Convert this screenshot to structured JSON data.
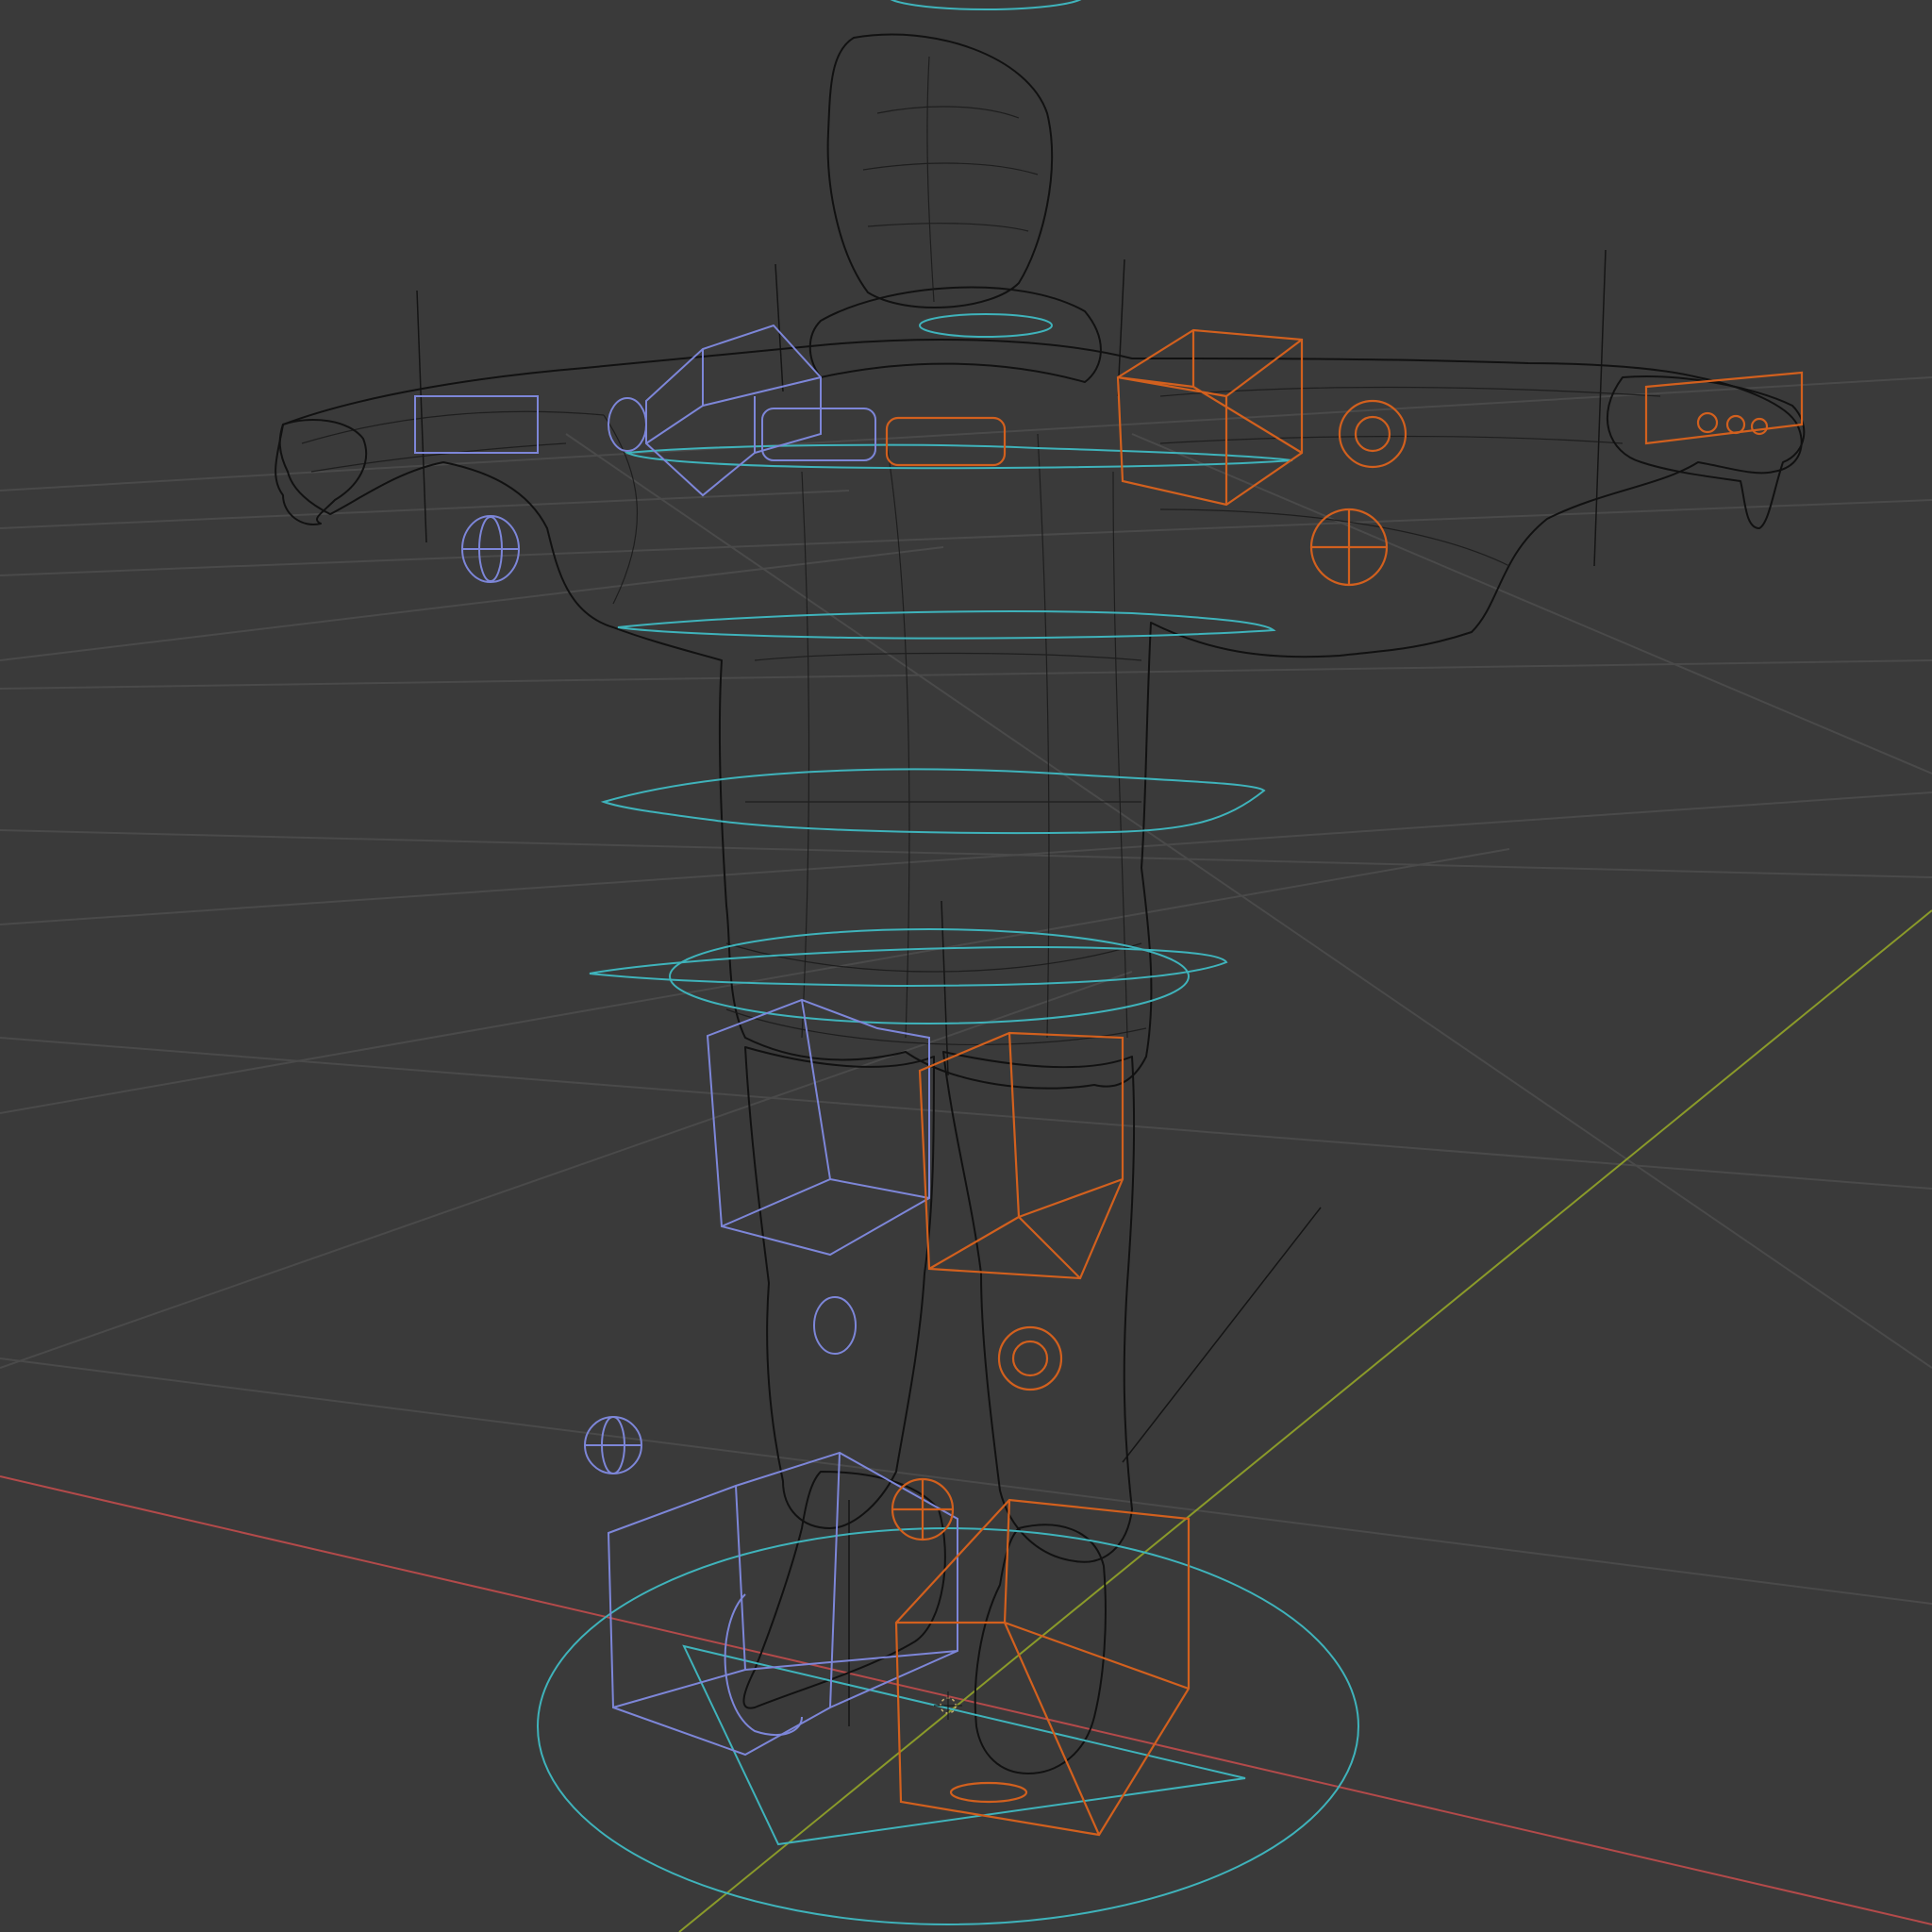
{
  "viewport": {
    "type": "3d-viewport",
    "shading": "wireframe",
    "background_color": "#3a3a3a",
    "grid_color": "#4a4a4a",
    "axis_colors": {
      "x_axis": "#b34a4a",
      "y_axis": "#8a9a2a"
    },
    "object": {
      "name": "character-mesh",
      "pose": "t-pose",
      "wire_color": "#111111"
    },
    "rig_controls": {
      "center_color": "#3fb3bb",
      "left_side_color": "#7d86d8",
      "right_side_color": "#d2601e"
    }
  }
}
